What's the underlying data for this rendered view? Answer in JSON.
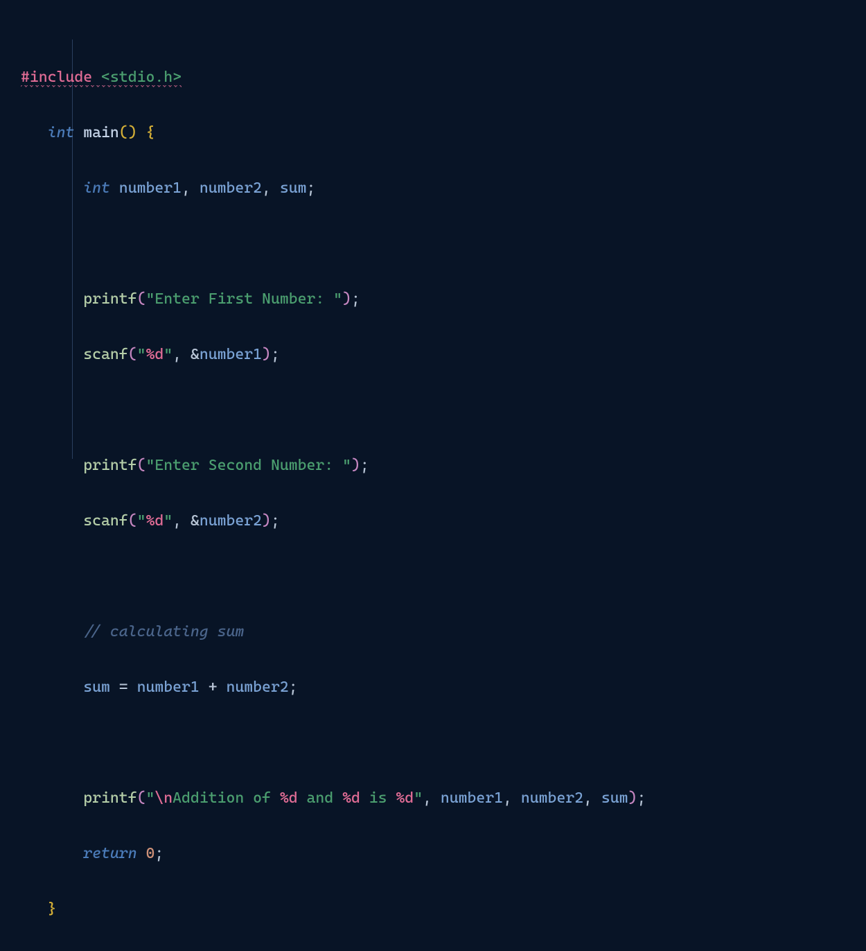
{
  "code": {
    "line1": {
      "include": "#include",
      "path": "<stdio.h>"
    },
    "line2": {
      "type": "int",
      "func": "main",
      "parens": "()",
      "brace": "{"
    },
    "line3": {
      "type": "int",
      "ident1": "number1",
      "ident2": "number2",
      "ident3": "sum"
    },
    "line5": {
      "func": "printf",
      "str": "\"Enter First Number: \""
    },
    "line6": {
      "func": "scanf",
      "fmt": "%d",
      "ident": "number1"
    },
    "line8": {
      "func": "printf",
      "str": "\"Enter Second Number: \""
    },
    "line9": {
      "func": "scanf",
      "fmt": "%d",
      "ident": "number2"
    },
    "line11": {
      "comment": "// calculating sum"
    },
    "line12": {
      "ident1": "sum",
      "ident2": "number1",
      "ident3": "number2"
    },
    "line14": {
      "func": "printf",
      "escape": "\\n",
      "str1": "Addition of ",
      "fmt1": "%d",
      "str2": " and ",
      "fmt2": "%d",
      "str3": " is ",
      "fmt3": "%d",
      "ident1": "number1",
      "ident2": "number2",
      "ident3": "sum"
    },
    "line15": {
      "keyword": "return",
      "num": "0"
    },
    "line16": {
      "brace": "}"
    }
  }
}
